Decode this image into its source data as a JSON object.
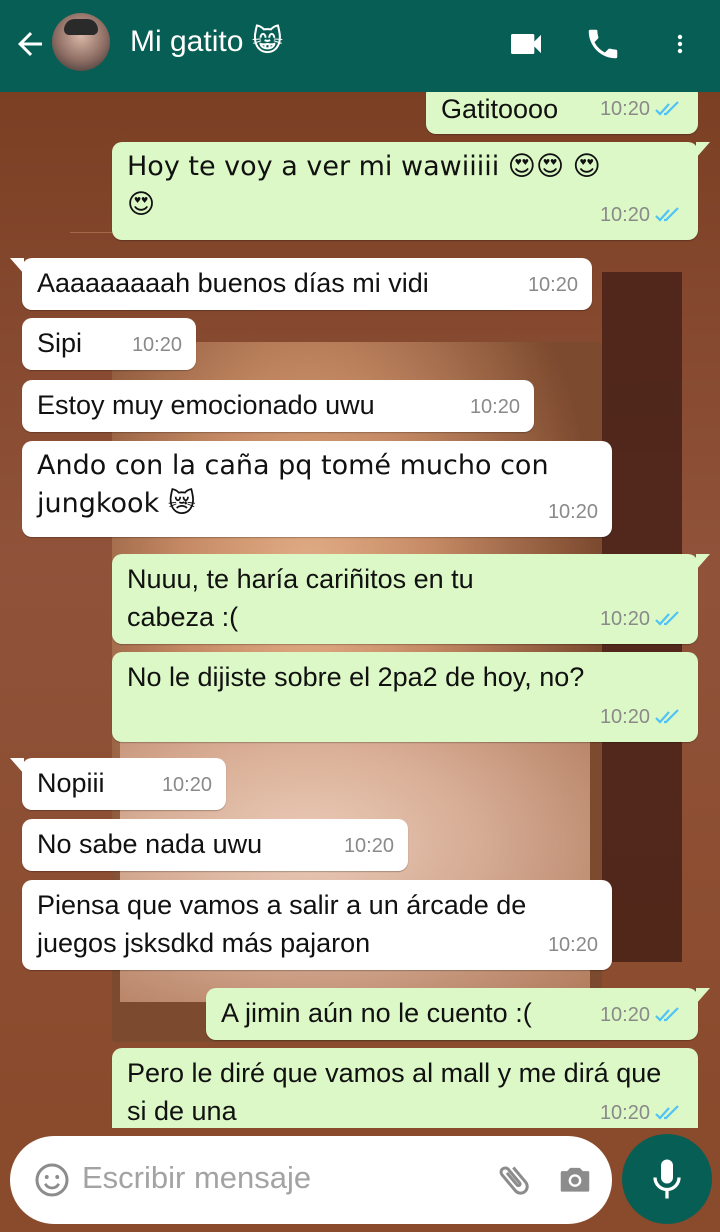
{
  "header": {
    "contact_name": "Mi gatito 😸",
    "back_icon": "arrow-back-icon",
    "video_icon": "video-call-icon",
    "call_icon": "phone-icon",
    "menu_icon": "more-vert-icon"
  },
  "messages": [
    {
      "dir": "out",
      "text": "Gatitoooo",
      "time": "10:20",
      "status": "read"
    },
    {
      "dir": "out",
      "text": "Hoy te voy a ver mi wawiiiii 😍😍 😍😍",
      "time": "10:20",
      "status": "read"
    },
    {
      "dir": "in",
      "text": "Aaaaaaaaah buenos días mi vidi",
      "time": "10:20"
    },
    {
      "dir": "in",
      "text": "Sipi",
      "time": "10:20"
    },
    {
      "dir": "in",
      "text": "Estoy muy emocionado uwu",
      "time": "10:20"
    },
    {
      "dir": "in",
      "text": "Ando con la caña pq tomé mucho con jungkook 😿",
      "time": "10:20"
    },
    {
      "dir": "out",
      "text": "Nuuu, te haría cariñitos en tu cabeza :(",
      "time": "10:20",
      "status": "read"
    },
    {
      "dir": "out",
      "text": "No le dijiste sobre el 2pa2 de hoy, no?",
      "time": "10:20",
      "status": "read"
    },
    {
      "dir": "in",
      "text": "Nopiii",
      "time": "10:20"
    },
    {
      "dir": "in",
      "text": "No sabe nada uwu",
      "time": "10:20"
    },
    {
      "dir": "in",
      "text": "Piensa que vamos a salir a un árcade de juegos jsksdkd más pajaron",
      "time": "10:20"
    },
    {
      "dir": "out",
      "text": "A jimin aún no le cuento :(",
      "time": "10:20",
      "status": "read"
    },
    {
      "dir": "out",
      "text": "Pero le diré que vamos al mall y me dirá que si de una",
      "time": "10:20",
      "status": "read"
    }
  ],
  "composer": {
    "placeholder": "Escribir mensaje",
    "emoji_icon": "emoji-icon",
    "attach_icon": "paperclip-icon",
    "camera_icon": "camera-icon",
    "mic_icon": "microphone-icon"
  },
  "colors": {
    "header": "#075e54",
    "outgoing_bubble": "#dcf8c6",
    "incoming_bubble": "#ffffff",
    "read_ticks": "#4fc3f7"
  }
}
